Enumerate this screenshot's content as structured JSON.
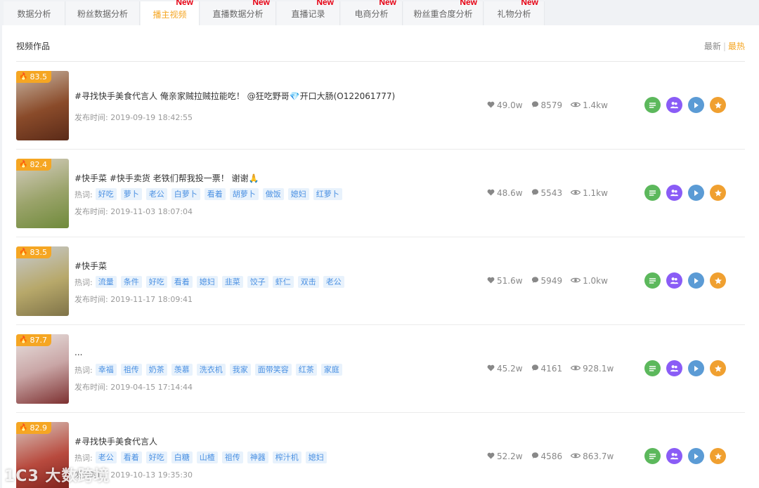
{
  "tabs": [
    {
      "label": "数据分析",
      "new": ""
    },
    {
      "label": "粉丝数据分析",
      "new": ""
    },
    {
      "label": "播主视频",
      "new": "New",
      "active": true
    },
    {
      "label": "直播数据分析",
      "new": "New"
    },
    {
      "label": "直播记录",
      "new": "New"
    },
    {
      "label": "电商分析",
      "new": "New"
    },
    {
      "label": "粉丝重合度分析",
      "new": "New"
    },
    {
      "label": "礼物分析",
      "new": "New"
    }
  ],
  "panel": {
    "title": "视频作品",
    "sort_newest": "最新",
    "sort_hottest": "最热"
  },
  "keyword_label": "热词:",
  "date_prefix": "发布时间:",
  "videos": [
    {
      "score": "83.5",
      "title": "#寻找快手美食代言人 俺亲家贼拉贼拉能吃！ @狂吃野哥💎开口大肠(O122061777)",
      "keywords": [],
      "date": "2019-09-19 18:42:55",
      "likes": "49.0w",
      "comments": "8579",
      "views": "1.4kw"
    },
    {
      "score": "82.4",
      "title": "#快手菜 #快手卖货 老铁们帮我投一票！ 谢谢🙏",
      "keywords": [
        "好吃",
        "萝卜",
        "老公",
        "白萝卜",
        "看着",
        "胡萝卜",
        "做饭",
        "媳妇",
        "红萝卜"
      ],
      "date": "2019-11-03 18:07:04",
      "likes": "48.6w",
      "comments": "5543",
      "views": "1.1kw"
    },
    {
      "score": "83.5",
      "title": "#快手菜",
      "keywords": [
        "流量",
        "条件",
        "好吃",
        "看着",
        "媳妇",
        "韭菜",
        "饺子",
        "虾仁",
        "双击",
        "老公"
      ],
      "date": "2019-11-17 18:09:41",
      "likes": "51.6w",
      "comments": "5949",
      "views": "1.0kw"
    },
    {
      "score": "87.7",
      "title": "...",
      "keywords": [
        "幸福",
        "祖传",
        "奶茶",
        "羡慕",
        "洗衣机",
        "我家",
        "面带笑容",
        "红茶",
        "家庭"
      ],
      "date": "2019-04-15 17:14:44",
      "likes": "45.2w",
      "comments": "4161",
      "views": "928.1w"
    },
    {
      "score": "82.9",
      "title": "#寻找快手美食代言人",
      "keywords": [
        "老公",
        "看着",
        "好吃",
        "白糖",
        "山楂",
        "祖传",
        "神器",
        "榨汁机",
        "媳妇"
      ],
      "date": "2019-10-13 19:35:30",
      "likes": "52.2w",
      "comments": "4586",
      "views": "863.7w"
    }
  ],
  "watermark": "1C3 大数跨境",
  "colors": {
    "accent": "#f5a623",
    "new_badge": "#e60012",
    "keyword_bg": "#e8f2fc",
    "keyword_text": "#4a90e2"
  }
}
